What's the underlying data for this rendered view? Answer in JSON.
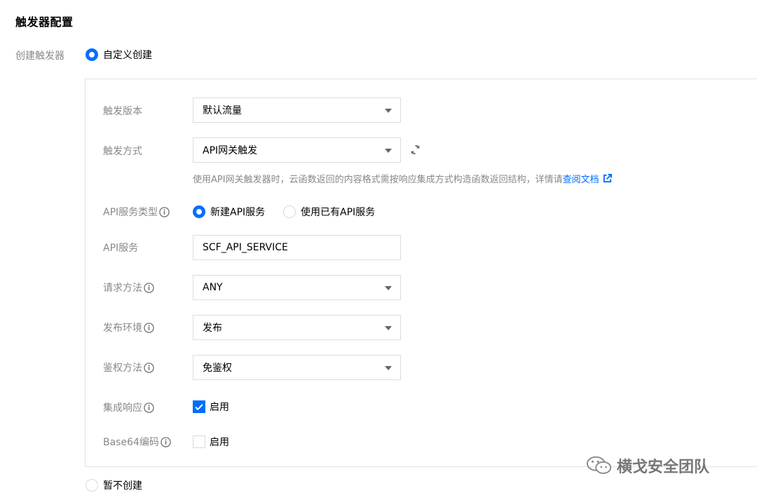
{
  "section_title": "触发器配置",
  "create_trigger": {
    "label": "创建触发器",
    "custom_option": "自定义创建",
    "none_option": "暂不创建"
  },
  "form": {
    "version": {
      "label": "触发版本",
      "value": "默认流量"
    },
    "method": {
      "label": "触发方式",
      "value": "API网关触发"
    },
    "help": {
      "text": "使用API网关触发器时，云函数返回的内容格式需按响应集成方式构造函数返回结构，详情请",
      "link": "查阅文档"
    },
    "service_type": {
      "label": "API服务类型",
      "option_new": "新建API服务",
      "option_existing": "使用已有API服务"
    },
    "service": {
      "label": "API服务",
      "value": "SCF_API_SERVICE"
    },
    "request_method": {
      "label": "请求方法",
      "value": "ANY"
    },
    "environment": {
      "label": "发布环境",
      "value": "发布"
    },
    "auth": {
      "label": "鉴权方法",
      "value": "免鉴权"
    },
    "integration": {
      "label": "集成响应",
      "option": "启用",
      "checked": true
    },
    "base64": {
      "label": "Base64编码",
      "option": "启用",
      "checked": false
    }
  },
  "watermark": "横戈安全团队",
  "colors": {
    "accent": "#006eff",
    "label": "#888888",
    "border": "#dcdcdc"
  },
  "icons": [
    "info-icon",
    "refresh-icon",
    "external-link-icon",
    "caret-down-icon",
    "wechat-icon"
  ]
}
